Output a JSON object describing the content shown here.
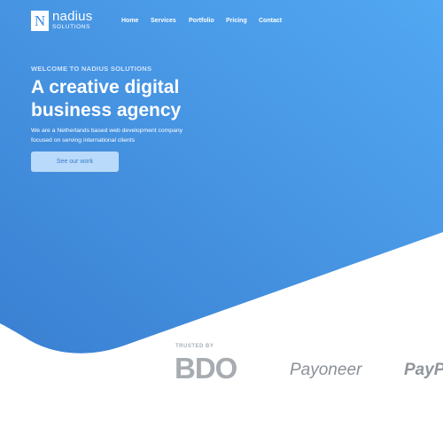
{
  "logo": {
    "letter": "N",
    "name": "nadius",
    "sub": "SOLUTIONS"
  },
  "nav": {
    "items": [
      "Home",
      "Services",
      "Portfolio",
      "Pricing",
      "Contact"
    ]
  },
  "hero": {
    "eyebrow": "WELCOME TO NADIUS SOLUTIONS",
    "headline_line1": "A creative digital",
    "headline_line2": "business agency",
    "description_line1": "We are a Netherlands based web development company",
    "description_line2": "focused on serving international clients",
    "cta_label": "See our work"
  },
  "trusted": {
    "label": "TRUSTED BY",
    "logos": [
      "BDO",
      "Payoneer",
      "PayPal"
    ]
  },
  "colors": {
    "hero_gradient_start": "#52a8f2",
    "hero_gradient_end": "#3a80d2",
    "button_bg": "#b9dafa",
    "button_text": "#3a7dc9",
    "logo_gray": "#8d949c"
  }
}
